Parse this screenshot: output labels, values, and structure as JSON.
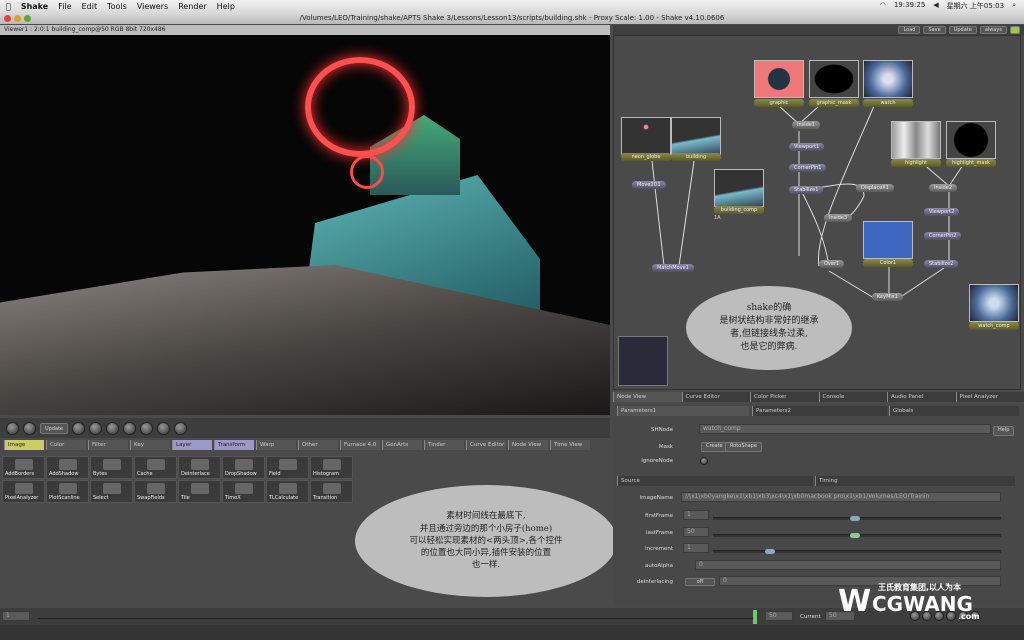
{
  "menubar": {
    "app": "Shake",
    "items": [
      "File",
      "Edit",
      "Tools",
      "Viewers",
      "Render",
      "Help"
    ],
    "clock": "19:39:25",
    "datetime": "星期六 上午05:03"
  },
  "window": {
    "title": "/Volumes/LEO/Training/shake/APTS Shake 3/Lessons/Lesson13/scripts/building.shk - Proxy Scale: 1.00 - Shake v4.10.0606"
  },
  "viewer": {
    "title": "Viewer1 : 2:0:1 building_comp@50 RGB 8bit 720x486"
  },
  "node_toolbar": {
    "buttons": [
      "Load",
      "Save",
      "Update",
      "always"
    ]
  },
  "nodes": {
    "thumbs": [
      {
        "label": "graphic"
      },
      {
        "label": "graphic_mask"
      },
      {
        "label": "watch"
      },
      {
        "label": "neon_globe"
      },
      {
        "label": "building"
      },
      {
        "label": "building_comp"
      },
      {
        "label": "highlight"
      },
      {
        "label": "highlight_mask"
      },
      {
        "label": "Color1"
      },
      {
        "label": "watch_comp"
      }
    ],
    "ops": [
      "Inside1",
      "Viewport1",
      "CornerPin1",
      "Stabilize1",
      "DisplaceX1",
      "Inside3",
      "Over1",
      "Inside2",
      "Viewport2",
      "CornerPin2",
      "Stabilize2",
      "KeyMix1",
      "Move2D1",
      "MatchMove1"
    ],
    "building_comp_frame": "1A"
  },
  "annotations": {
    "node_bubble": [
      "shake的确",
      "是树状结构非常好的继承",
      "者,但链接线条过柔,",
      "也是它的弊病."
    ],
    "tool_bubble": [
      "素材时间线在最底下,",
      "并且通过旁边的那个小房子(home)",
      "可以轻松实现素材的<两头顶>,各个控件",
      "的位置也大同小异,插件安装的位置",
      "也一样."
    ]
  },
  "viewer_tools": {
    "update_label": "Update"
  },
  "tool_tabs": [
    "Image",
    "Color",
    "Filter",
    "Key",
    "Layer",
    "Transform",
    "Warp",
    "Other",
    "Furnace 4.0",
    "GenArts",
    "Tinder",
    "Curve Editor",
    "Node View",
    "Time View"
  ],
  "tools": [
    "AddBorders",
    "AddShadow",
    "Bytes",
    "Cache",
    "Deinterlace",
    "DropShadow",
    "Field",
    "Histogram",
    "PixelAnalyzer",
    "PlotScanline",
    "Select",
    "SwapFields",
    "Tile",
    "TimeX",
    "TLCalculate",
    "Transition"
  ],
  "panel_tabs": [
    "Node View",
    "Curve Editor",
    "Color Picker",
    "Console",
    "Audio Panel",
    "Pixel Analyzer"
  ],
  "param_tabs": [
    "Parameters1",
    "Parameters2",
    "Globals"
  ],
  "params": {
    "shake_label": "SHNode",
    "shake_value": "watch_comp",
    "help": "Help",
    "mask_label": "Mask",
    "mask_create": "Create",
    "mask_type": "RotoShape",
    "ignore_label": "ignoreNode",
    "sections": [
      "Source",
      "Timing"
    ],
    "imageName_label": "imageName",
    "imageName": "//\\x1\\xb0yangke\\x1\\xb1\\xb3\\xc4\\x1\\xb0macbook pro\\x1\\xb1/Volumes/LEO/Trainin",
    "firstFrame_label": "firstFrame",
    "firstFrame": "1",
    "lastFrame_label": "lastFrame",
    "lastFrame": "50",
    "increment_label": "increment",
    "increment": "1",
    "autoAlpha_label": "autoAlpha",
    "autoAlpha": "0",
    "deinterlacing_label": "deinterlacing",
    "deinterlacing_mode": "off",
    "deinterlacing": "0"
  },
  "timeline": {
    "start": "1",
    "end": "50",
    "current_label": "Current",
    "current": "50"
  },
  "watermark": {
    "brand": "CGWANG",
    "sub": ".com",
    "slogan": "王氏教育集团,以人为本"
  }
}
